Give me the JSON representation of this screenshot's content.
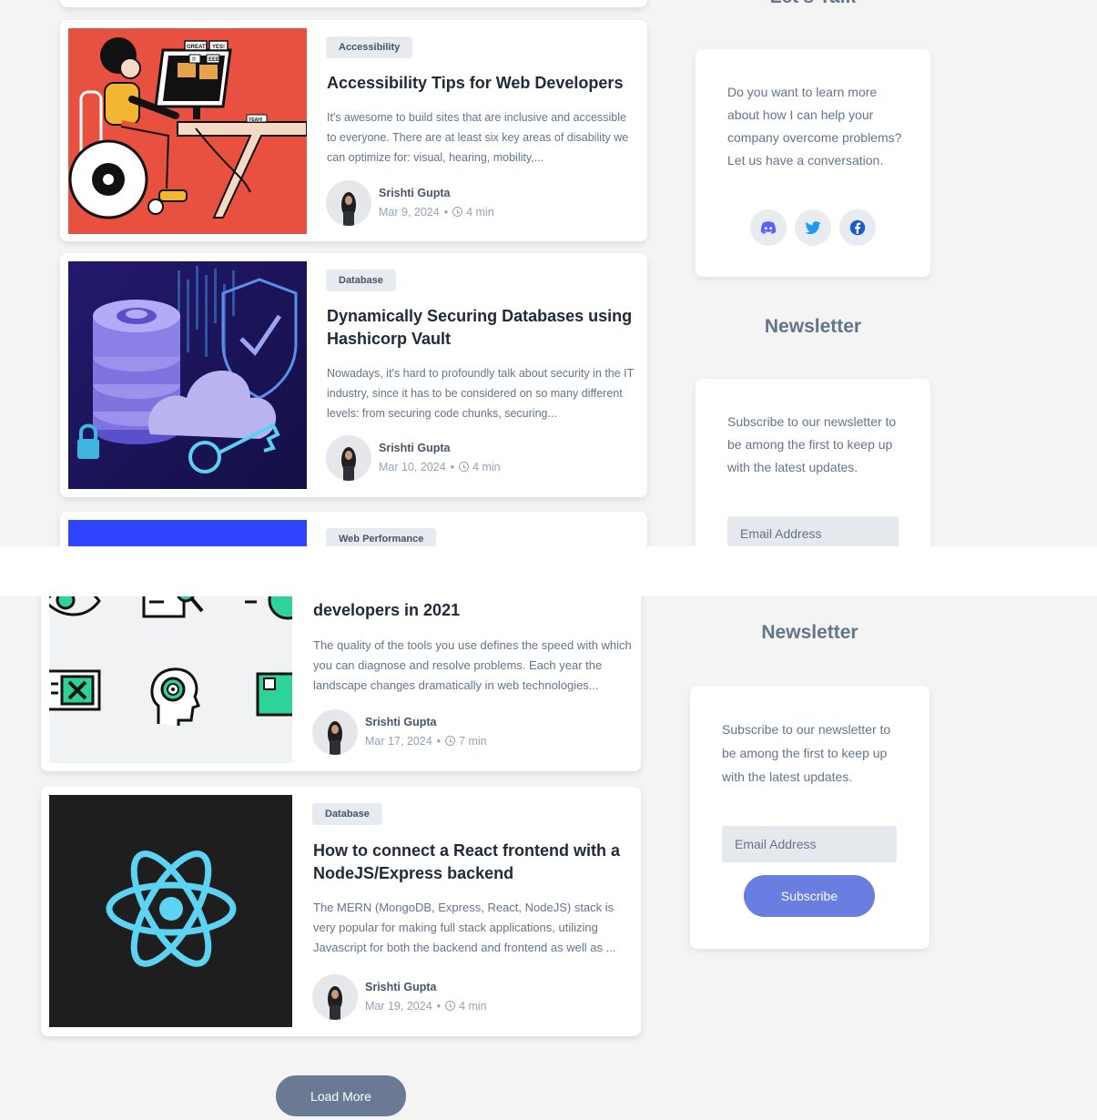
{
  "top": {
    "sidebar_cut_heading": "Let's Talk",
    "posts": [
      {
        "tag": "Accessibility",
        "title": "Accessibility Tips for Web Developers",
        "excerpt": "It's awesome to build sites that are inclusive and accessible to everyone. There are at least six key areas of disability we can optimize for: visual, hearing, mobility,...",
        "author": "Srishti Gupta",
        "date": "Mar 9, 2024",
        "read_time": "4 min",
        "image_text": [
          "GREAT!",
          "YES!",
          "!!",
          "EEE",
          "YEAH!"
        ]
      },
      {
        "tag": "Database",
        "title": "Dynamically Securing Databases using Hashicorp Vault",
        "excerpt": "Nowadays, it's hard to profoundly talk about security in the IT industry, since it has to be considered on so many different levels: from securing code chunks, securing...",
        "author": "Srishti Gupta",
        "date": "Mar 10, 2024",
        "read_time": "4 min"
      },
      {
        "tag": "Web Performance"
      }
    ],
    "talk": {
      "text": "Do you want to learn more about how I can help your company overcome problems? Let us have a conversation.",
      "social_icons": [
        "discord-icon",
        "twitter-icon",
        "facebook-icon"
      ]
    },
    "newsletter": {
      "heading": "Newsletter",
      "text": "Subscribe to our newsletter to be among the first to keep up with the latest updates.",
      "email_placeholder": "Email Address"
    }
  },
  "bottom": {
    "posts": [
      {
        "title": "developers in 2021",
        "excerpt": "The quality of the tools you use defines the speed with which you can diagnose and resolve problems. Each year the landscape changes dramatically in web technologies...",
        "author": "Srishti Gupta",
        "date": "Mar 17, 2024",
        "read_time": "7 min"
      },
      {
        "tag": "Database",
        "title": "How to connect a React frontend with a NodeJS/Express backend",
        "excerpt": "The MERN (MongoDB, Express, React, NodeJS) stack is very popular for making full stack applications, utilizing Javascript for both the backend and frontend as well as ...",
        "author": "Srishti Gupta",
        "date": "Mar 19, 2024",
        "read_time": "4 min"
      }
    ],
    "newsletter": {
      "heading": "Newsletter",
      "text": "Subscribe to our newsletter to be among the first to keep up with the latest updates.",
      "email_placeholder": "Email Address",
      "button": "Subscribe"
    },
    "load_more": "Load More"
  },
  "colors": {
    "page_bg": "#f4f4f5",
    "accent": "#6a7ee2",
    "load_more": "#6b7a94",
    "tag_bg": "#e7eaef"
  }
}
